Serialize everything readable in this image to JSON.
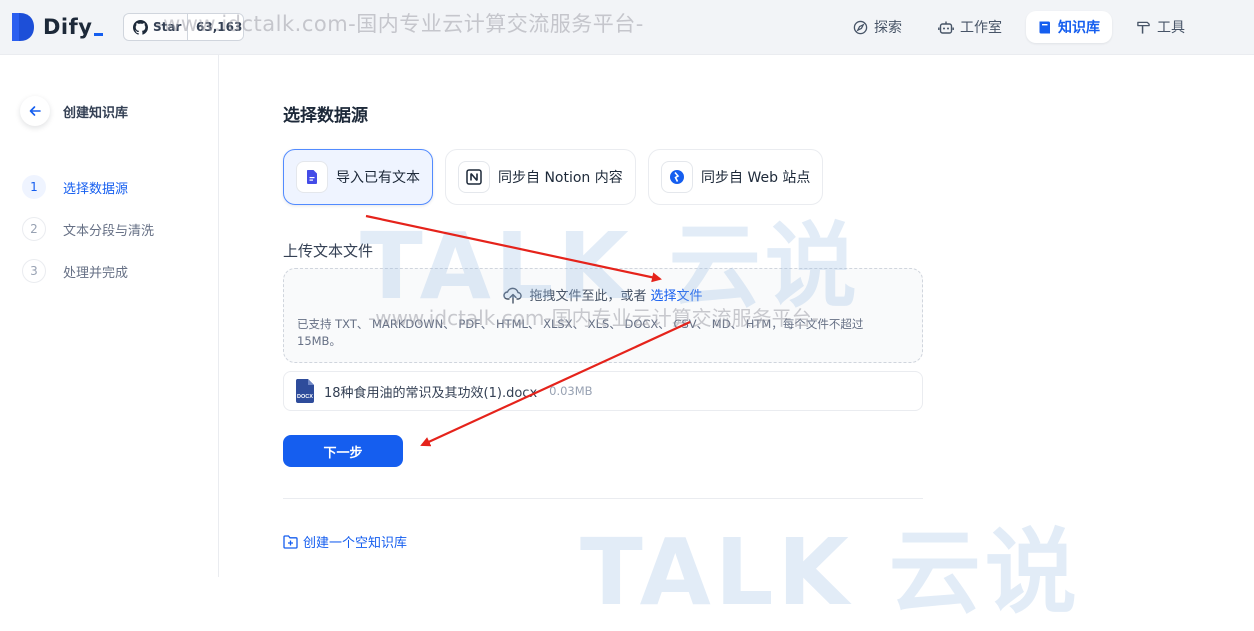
{
  "brand": {
    "name": "Dify",
    "star_label": "Star",
    "star_count": "63,163",
    "accent": "#155eef"
  },
  "watermarks": {
    "top": "-www.idctalk.com-国内专业云计算交流服务平台-",
    "middle": "-www.idctalk.com-国内专业云计算交流服务平台-",
    "logo_text": "TALK 云说"
  },
  "nav": [
    {
      "label": "探索",
      "icon": "compass-icon"
    },
    {
      "label": "工作室",
      "icon": "robot-icon"
    },
    {
      "label": "知识库",
      "icon": "book-icon",
      "active": true
    },
    {
      "label": "工具",
      "icon": "hammer-icon"
    }
  ],
  "sidebar": {
    "back_title": "创建知识库",
    "steps": [
      {
        "num": "1",
        "label": "选择数据源",
        "active": true
      },
      {
        "num": "2",
        "label": "文本分段与清洗"
      },
      {
        "num": "3",
        "label": "处理并完成"
      }
    ]
  },
  "main": {
    "title": "选择数据源",
    "sources": [
      {
        "label": "导入已有文本",
        "icon": "file-text-icon",
        "active": true
      },
      {
        "label": "同步自 Notion 内容",
        "icon": "notion-icon"
      },
      {
        "label": "同步自 Web 站点",
        "icon": "web-icon"
      }
    ],
    "upload_label": "上传文本文件",
    "drop_text": "拖拽文件至此，或者",
    "drop_link": "选择文件",
    "drop_hint": "已支持 TXT、 MARKDOWN、 PDF、 HTML、 XLSX、 XLS、 DOCX、 CSV、 MD、 HTM，每个文件不超过 15MB。",
    "file": {
      "name": "18种食用油的常识及其功效(1).docx",
      "size": "0.03MB",
      "badge": "DOCX"
    },
    "next_label": "下一步",
    "empty_link": "创建一个空知识库"
  },
  "annotation_color": "#e5231b"
}
